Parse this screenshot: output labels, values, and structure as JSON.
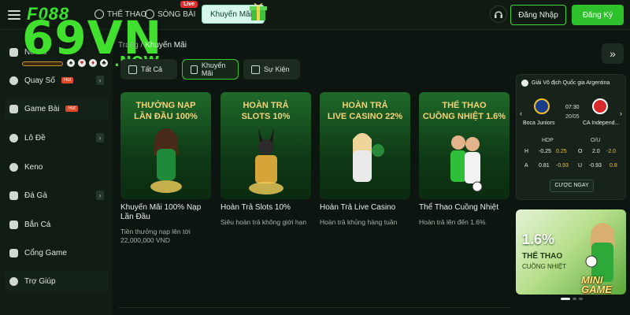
{
  "topbar": {
    "logo": "F088",
    "nav": [
      {
        "label": "THỂ THAO",
        "icon": "soccer-ball-icon"
      },
      {
        "label": "SÒNG BÀI",
        "icon": "casino-chip-icon",
        "badge": "Live"
      }
    ],
    "promo_button": "Khuyến Mãi",
    "login": "Đăng Nhập",
    "register": "Đăng Ký"
  },
  "watermark": {
    "main": "69VN",
    "sub": ".NOW"
  },
  "sidebar": {
    "items": [
      {
        "label": "Nổ Hũ",
        "icon": "slot-icon"
      },
      {
        "label": "Quay Số",
        "icon": "lottery-icon",
        "badge": "Hot"
      },
      {
        "label": "Game Bài",
        "icon": "cards-icon",
        "badge": "Hot"
      },
      {
        "label": "Lô Đề",
        "icon": "lotto-icon"
      },
      {
        "label": "Keno",
        "icon": "keno-icon"
      },
      {
        "label": "Đá Gà",
        "icon": "rooster-icon"
      },
      {
        "label": "Bắn Cá",
        "icon": "fish-icon"
      },
      {
        "label": "Cổng Game",
        "icon": "gamepad-icon"
      },
      {
        "label": "Trợ Giúp",
        "icon": "help-icon"
      }
    ]
  },
  "breadcrumb": {
    "home": "Trang",
    "sep": "/",
    "current": "Khuyến Mãi"
  },
  "tabs": [
    {
      "label": "Tất Cả"
    },
    {
      "label": "Khuyến Mãi"
    },
    {
      "label": "Sự Kiện"
    }
  ],
  "promos": [
    {
      "headline1": "THƯỞNG NẠP",
      "headline2": "LẦN ĐẦU 100%",
      "title": "Khuyến Mãi 100% Nạp Lần Đầu",
      "sub": "Tiền thưởng nạp lên tới 22,000,000 VND"
    },
    {
      "headline1": "HOÀN TRẢ",
      "headline2": "SLOTS 10%",
      "title": "Hoàn Trả Slots 10%",
      "sub": "Siêu hoàn trả không giới hạn"
    },
    {
      "headline1": "HOÀN TRẢ",
      "headline2": "LIVE CASINO 22%",
      "title": "Hoàn Trả Live Casino",
      "sub": "Hoàn trả khủng hàng tuần"
    },
    {
      "headline1": "THỂ THAO",
      "headline2": "CUỒNG NHIỆT 1.6%",
      "title": "Thể Thao Cuồng Nhiệt",
      "sub": "Hoàn trả lên đến 1.6%"
    }
  ],
  "match": {
    "league": "Giải Vô địch Quốc gia Argentina",
    "time": "07:30",
    "date": "20/05",
    "home": "Boca Juniors",
    "away": "CA Independ...",
    "hdp_label": "HDP",
    "ou_label": "O/U",
    "rows": [
      {
        "k": "H",
        "line": "-0.25",
        "odd": "0.25",
        "k2": "O",
        "line2": "2.0",
        "odd2": "-2.0"
      },
      {
        "k": "A",
        "line": "0.81",
        "odd": "-0.93",
        "k2": "U",
        "line2": "-0.93",
        "odd2": "0.8"
      }
    ],
    "bet": "CƯỢC NGAY"
  },
  "banner": {
    "pct": "1.6%",
    "line1": "THỂ THAO",
    "line2": "CUỒNG NHIỆT",
    "game": "MINI GAME"
  },
  "colors": {
    "accent": "#2fc12b",
    "bg": "#0d1510",
    "gold": "#f3d27a"
  }
}
